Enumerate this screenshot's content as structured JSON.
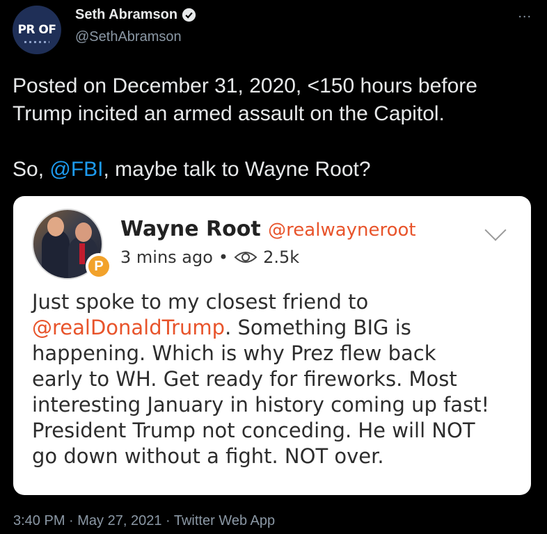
{
  "header": {
    "avatar_text": "PR OF",
    "name": "Seth Abramson",
    "handle": "@SethAbramson",
    "more_icon": "..."
  },
  "tweet": {
    "line1": "Posted on December 31, 2020, <150 hours before",
    "line2": "Trump incited an armed assault on the Capitol.",
    "line4_prefix": "So, ",
    "line4_mention": "@FBI",
    "line4_suffix": ", maybe talk to Wayne Root?"
  },
  "card": {
    "name": "Wayne Root",
    "handle": "@realwayneroot",
    "time": "3 mins ago",
    "dot": "•",
    "views": "2.5k",
    "badge_letter": "P",
    "body": {
      "line1": "Just spoke to my closest friend to",
      "line2_mention": "@realDonaldTrump",
      "line2_suffix": ". Something BIG is",
      "line3": "happening. Which is why Prez flew back",
      "line4": "early to WH. Get ready for fireworks. Most",
      "line5": "interesting January in history coming up fast!",
      "line6": "President Trump not conceding. He will NOT",
      "line7": "go down without a fight. NOT over."
    }
  },
  "footer": {
    "text": "3:40 PM · May 27, 2021 · Twitter Web App"
  },
  "colors": {
    "background": "#000000",
    "link": "#1d9bf0",
    "card_link": "#e8542b"
  }
}
